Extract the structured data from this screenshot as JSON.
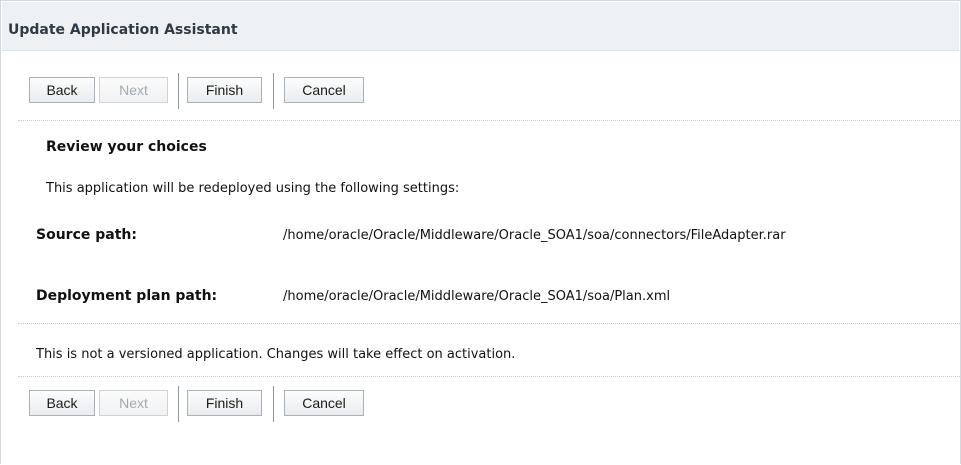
{
  "window": {
    "title": "Update Application Assistant"
  },
  "toolbar": {
    "back_label": "Back",
    "next_label": "Next",
    "finish_label": "Finish",
    "cancel_label": "Cancel"
  },
  "review": {
    "heading": "Review your choices",
    "intro": "This application will be redeployed using the following settings:",
    "source_path_label": "Source path:",
    "source_path_value": "/home/oracle/Oracle/Middleware/Oracle_SOA1/soa/connectors/FileAdapter.rar",
    "deployment_plan_label": "Deployment plan path:",
    "deployment_plan_value": "/home/oracle/Oracle/Middleware/Oracle_SOA1/soa/Plan.xml",
    "version_note": "This is not a versioned application. Changes will take effect on activation."
  },
  "bottom_toolbar": {
    "back_label": "Back",
    "next_label": "Next",
    "finish_label": "Finish",
    "cancel_label": "Cancel"
  },
  "colors": {
    "title_bar_bg": "#eef1f4",
    "button_border": "#a9b0b6",
    "disabled_text": "#a4a9ae"
  },
  "state": {
    "next_disabled": true
  }
}
